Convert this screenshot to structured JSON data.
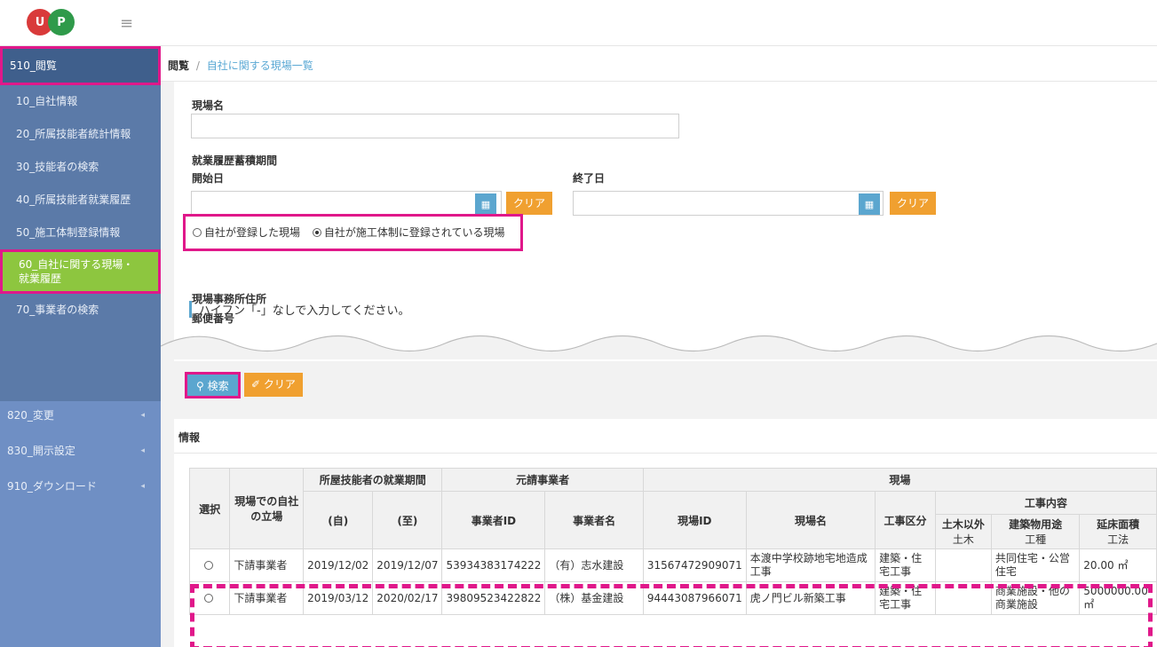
{
  "logo": {
    "letter1": "U",
    "letter2": "P"
  },
  "sidebar": {
    "header": "510_閲覧",
    "items": [
      {
        "label": "10_自社情報"
      },
      {
        "label": "20_所属技能者統計情報"
      },
      {
        "label": "30_技能者の検索"
      },
      {
        "label": "40_所属技能者就業履歴"
      },
      {
        "label": "50_施工体制登録情報"
      },
      {
        "label_line1": "60_自社に関する現場・",
        "label_line2": "就業履歴"
      },
      {
        "label": "70_事業者の検索"
      }
    ],
    "lower_items": [
      {
        "label": "820_変更"
      },
      {
        "label": "830_開示設定"
      },
      {
        "label": "910_ダウンロード"
      }
    ]
  },
  "breadcrumb": {
    "root": "閲覧",
    "sep": "/",
    "current": "自社に関する現場一覧"
  },
  "form": {
    "site_name_label": "現場名",
    "period_label": "就業履歴蓄積期間",
    "start_label": "開始日",
    "end_label": "終了日",
    "clear_label": "クリア",
    "radio1": "自社が登録した現場",
    "radio2": "自社が施工体制に登録されている現場",
    "address_label": "現場事務所住所",
    "postal_label": "郵便番号",
    "hint": "ハイフン「-」なしで入力してください。"
  },
  "search": {
    "search_label": "検索",
    "clear_label": "クリア"
  },
  "info": {
    "title": "情報"
  },
  "table": {
    "h_select": "選択",
    "h_role": "現場での自社の立場",
    "h_period": "所屋技能者の就業期間",
    "h_from": "(自)",
    "h_to": "(至)",
    "h_contractor": "元請事業者",
    "h_biz_id": "事業者ID",
    "h_biz_name": "事業者名",
    "h_site": "現場",
    "h_site_id": "現場ID",
    "h_site_name": "現場名",
    "h_work_type": "工事区分",
    "h_work_content": "工事内容",
    "h_non_civil": "土木以外",
    "h_civil": "土木",
    "h_use": "建築物用途",
    "h_kind": "工種",
    "h_area": "延床面積",
    "h_method": "工法",
    "rows": [
      {
        "role": "下請事業者",
        "from": "2019/12/02",
        "to": "2019/12/07",
        "biz_id": "53934383174222",
        "biz_name": "（有）志水建設",
        "site_id": "31567472909071",
        "site_name": "本渡中学校跡地宅地造成工事",
        "work_type": "建築・住宅工事",
        "non_civil": "",
        "use": "共同住宅・公営住宅",
        "area": "20.00 ㎡"
      },
      {
        "role": "下請事業者",
        "from": "2019/03/12",
        "to": "2020/02/17",
        "biz_id": "39809523422822",
        "biz_name": "（株）基金建設",
        "site_id": "94443087966071",
        "site_name": "虎ノ門ビル新築工事",
        "work_type": "建築・住宅工事",
        "non_civil": "",
        "use": "商業施設・他の商業施設",
        "area": "5000000.00 ㎡"
      }
    ]
  }
}
